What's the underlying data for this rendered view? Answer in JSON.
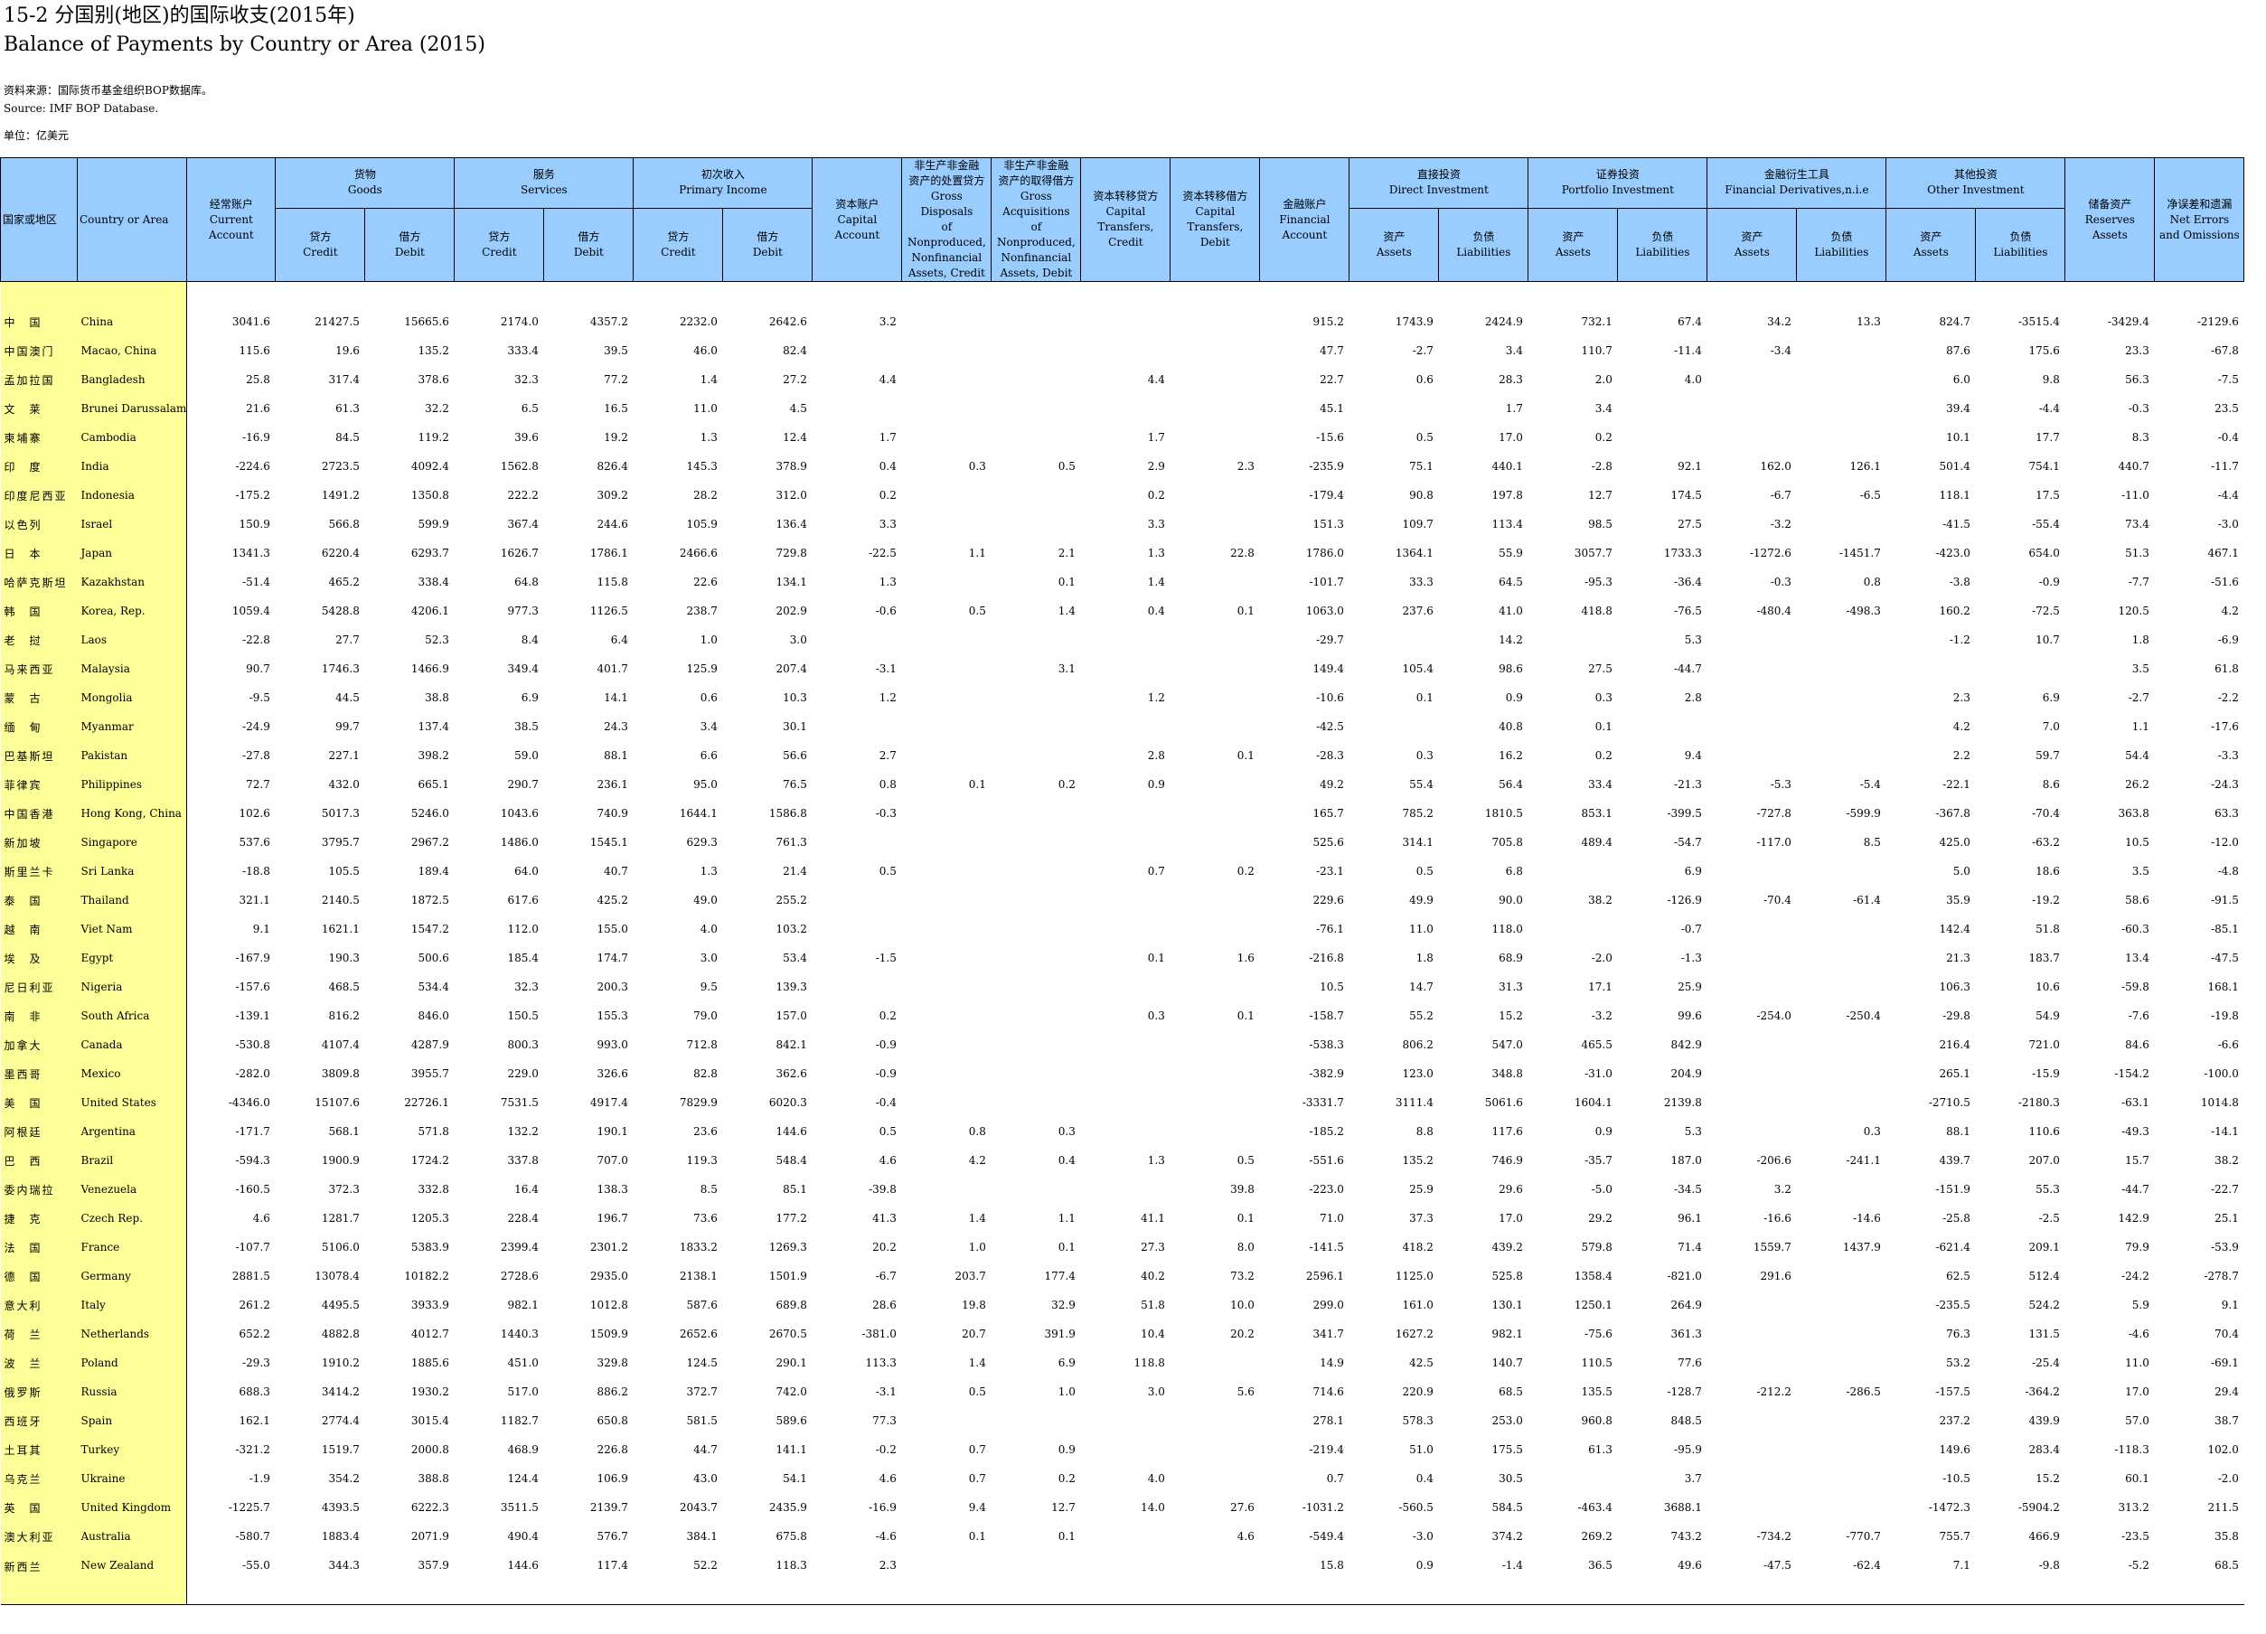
{
  "title_cn": "15-2  分国别(地区)的国际收支(2015年)",
  "title_en": "Balance of Payments by Country or Area (2015)",
  "source_cn": "资料来源：国际货币基金组织BOP数据库。",
  "source_en": "Source: IMF BOP Database.",
  "unit": "单位：亿美元",
  "headers": {
    "country_cn": "国家或地区",
    "country_en": "Country or Area",
    "current": [
      "经常账户",
      "Current",
      "Account"
    ],
    "goods": [
      "货物",
      "Goods"
    ],
    "services": [
      "服务",
      "Services"
    ],
    "primary": [
      "初次收入",
      "Primary Income"
    ],
    "credit": [
      "贷方",
      "Credit"
    ],
    "debit": [
      "借方",
      "Debit"
    ],
    "capital": [
      "资本账户",
      "Capital",
      "Account"
    ],
    "nonprod_credit": [
      "非生产非金融",
      "资产的处置贷方",
      "Gross Disposals",
      "of Nonproduced,",
      "Nonfinancial",
      "Assets, Credit"
    ],
    "nonprod_debit": [
      "非生产非金融",
      "资产的取得借方",
      "Gross Acquisitions",
      "of Nonproduced,",
      "Nonfinancial",
      "Assets, Debit"
    ],
    "cap_trans_credit": [
      "资本转移贷方",
      "Capital",
      "Transfers,",
      "Credit"
    ],
    "cap_trans_debit": [
      "资本转移借方",
      "Capital",
      "Transfers,",
      "Debit"
    ],
    "financial": [
      "金融账户",
      "Financial",
      "Account"
    ],
    "direct": [
      "直接投资",
      "Direct Investment"
    ],
    "portfolio": [
      "证券投资",
      "Portfolio Investment"
    ],
    "derivatives": [
      "金融衍生工具",
      "Financial Derivatives,n.i.e"
    ],
    "other": [
      "其他投资",
      "Other Investment"
    ],
    "assets": [
      "资产",
      "Assets"
    ],
    "liabilities": [
      "负债",
      "Liabilities"
    ],
    "reserves": [
      "储备资产",
      "Reserves",
      "Assets"
    ],
    "errors": [
      "净误差和遗漏",
      "Net Errors",
      "and Omissions"
    ]
  },
  "rows": [
    [
      "中　国",
      "China",
      "3041.6",
      "21427.5",
      "15665.6",
      "2174.0",
      "4357.2",
      "2232.0",
      "2642.6",
      "3.2",
      "",
      "",
      "",
      "",
      "915.2",
      "1743.9",
      "2424.9",
      "732.1",
      "67.4",
      "34.2",
      "13.3",
      "824.7",
      "-3515.4",
      "-3429.4",
      "-2129.6"
    ],
    [
      "中国澳门",
      "Macao, China",
      "115.6",
      "19.6",
      "135.2",
      "333.4",
      "39.5",
      "46.0",
      "82.4",
      "",
      "",
      "",
      "",
      "",
      "47.7",
      "-2.7",
      "3.4",
      "110.7",
      "-11.4",
      "-3.4",
      "",
      "87.6",
      "175.6",
      "23.3",
      "-67.8"
    ],
    [
      "孟加拉国",
      "Bangladesh",
      "25.8",
      "317.4",
      "378.6",
      "32.3",
      "77.2",
      "1.4",
      "27.2",
      "4.4",
      "",
      "",
      "4.4",
      "",
      "22.7",
      "0.6",
      "28.3",
      "2.0",
      "4.0",
      "",
      "",
      "6.0",
      "9.8",
      "56.3",
      "-7.5"
    ],
    [
      "文　莱",
      "Brunei Darussalam",
      "21.6",
      "61.3",
      "32.2",
      "6.5",
      "16.5",
      "11.0",
      "4.5",
      "",
      "",
      "",
      "",
      "",
      "45.1",
      "",
      "1.7",
      "3.4",
      "",
      "",
      "",
      "39.4",
      "-4.4",
      "-0.3",
      "23.5"
    ],
    [
      "柬埔寨",
      "Cambodia",
      "-16.9",
      "84.5",
      "119.2",
      "39.6",
      "19.2",
      "1.3",
      "12.4",
      "1.7",
      "",
      "",
      "1.7",
      "",
      "-15.6",
      "0.5",
      "17.0",
      "0.2",
      "",
      "",
      "",
      "10.1",
      "17.7",
      "8.3",
      "-0.4"
    ],
    [
      "印　度",
      "India",
      "-224.6",
      "2723.5",
      "4092.4",
      "1562.8",
      "826.4",
      "145.3",
      "378.9",
      "0.4",
      "0.3",
      "0.5",
      "2.9",
      "2.3",
      "-235.9",
      "75.1",
      "440.1",
      "-2.8",
      "92.1",
      "162.0",
      "126.1",
      "501.4",
      "754.1",
      "440.7",
      "-11.7"
    ],
    [
      "印度尼西亚",
      "Indonesia",
      "-175.2",
      "1491.2",
      "1350.8",
      "222.2",
      "309.2",
      "28.2",
      "312.0",
      "0.2",
      "",
      "",
      "0.2",
      "",
      "-179.4",
      "90.8",
      "197.8",
      "12.7",
      "174.5",
      "-6.7",
      "-6.5",
      "118.1",
      "17.5",
      "-11.0",
      "-4.4"
    ],
    [
      "以色列",
      "Israel",
      "150.9",
      "566.8",
      "599.9",
      "367.4",
      "244.6",
      "105.9",
      "136.4",
      "3.3",
      "",
      "",
      "3.3",
      "",
      "151.3",
      "109.7",
      "113.4",
      "98.5",
      "27.5",
      "-3.2",
      "",
      "-41.5",
      "-55.4",
      "73.4",
      "-3.0"
    ],
    [
      "日　本",
      "Japan",
      "1341.3",
      "6220.4",
      "6293.7",
      "1626.7",
      "1786.1",
      "2466.6",
      "729.8",
      "-22.5",
      "1.1",
      "2.1",
      "1.3",
      "22.8",
      "1786.0",
      "1364.1",
      "55.9",
      "3057.7",
      "1733.3",
      "-1272.6",
      "-1451.7",
      "-423.0",
      "654.0",
      "51.3",
      "467.1"
    ],
    [
      "哈萨克斯坦",
      "Kazakhstan",
      "-51.4",
      "465.2",
      "338.4",
      "64.8",
      "115.8",
      "22.6",
      "134.1",
      "1.3",
      "",
      "0.1",
      "1.4",
      "",
      "-101.7",
      "33.3",
      "64.5",
      "-95.3",
      "-36.4",
      "-0.3",
      "0.8",
      "-3.8",
      "-0.9",
      "-7.7",
      "-51.6"
    ],
    [
      "韩　国",
      "Korea, Rep.",
      "1059.4",
      "5428.8",
      "4206.1",
      "977.3",
      "1126.5",
      "238.7",
      "202.9",
      "-0.6",
      "0.5",
      "1.4",
      "0.4",
      "0.1",
      "1063.0",
      "237.6",
      "41.0",
      "418.8",
      "-76.5",
      "-480.4",
      "-498.3",
      "160.2",
      "-72.5",
      "120.5",
      "4.2"
    ],
    [
      "老　挝",
      "Laos",
      "-22.8",
      "27.7",
      "52.3",
      "8.4",
      "6.4",
      "1.0",
      "3.0",
      "",
      "",
      "",
      "",
      "",
      "-29.7",
      "",
      "14.2",
      "",
      "5.3",
      "",
      "",
      "-1.2",
      "10.7",
      "1.8",
      "-6.9"
    ],
    [
      "马来西亚",
      "Malaysia",
      "90.7",
      "1746.3",
      "1466.9",
      "349.4",
      "401.7",
      "125.9",
      "207.4",
      "-3.1",
      "",
      "3.1",
      "",
      "",
      "149.4",
      "105.4",
      "98.6",
      "27.5",
      "-44.7",
      "",
      "",
      "",
      "",
      "3.5",
      "61.8"
    ],
    [
      "蒙　古",
      "Mongolia",
      "-9.5",
      "44.5",
      "38.8",
      "6.9",
      "14.1",
      "0.6",
      "10.3",
      "1.2",
      "",
      "",
      "1.2",
      "",
      "-10.6",
      "0.1",
      "0.9",
      "0.3",
      "2.8",
      "",
      "",
      "2.3",
      "6.9",
      "-2.7",
      "-2.2"
    ],
    [
      "缅　甸",
      "Myanmar",
      "-24.9",
      "99.7",
      "137.4",
      "38.5",
      "24.3",
      "3.4",
      "30.1",
      "",
      "",
      "",
      "",
      "",
      "-42.5",
      "",
      "40.8",
      "0.1",
      "",
      "",
      "",
      "4.2",
      "7.0",
      "1.1",
      "-17.6"
    ],
    [
      "巴基斯坦",
      "Pakistan",
      "-27.8",
      "227.1",
      "398.2",
      "59.0",
      "88.1",
      "6.6",
      "56.6",
      "2.7",
      "",
      "",
      "2.8",
      "0.1",
      "-28.3",
      "0.3",
      "16.2",
      "0.2",
      "9.4",
      "",
      "",
      "2.2",
      "59.7",
      "54.4",
      "-3.3"
    ],
    [
      "菲律宾",
      "Philippines",
      "72.7",
      "432.0",
      "665.1",
      "290.7",
      "236.1",
      "95.0",
      "76.5",
      "0.8",
      "0.1",
      "0.2",
      "0.9",
      "",
      "49.2",
      "55.4",
      "56.4",
      "33.4",
      "-21.3",
      "-5.3",
      "-5.4",
      "-22.1",
      "8.6",
      "26.2",
      "-24.3"
    ],
    [
      "中国香港",
      "Hong Kong, China",
      "102.6",
      "5017.3",
      "5246.0",
      "1043.6",
      "740.9",
      "1644.1",
      "1586.8",
      "-0.3",
      "",
      "",
      "",
      "",
      "165.7",
      "785.2",
      "1810.5",
      "853.1",
      "-399.5",
      "-727.8",
      "-599.9",
      "-367.8",
      "-70.4",
      "363.8",
      "63.3"
    ],
    [
      "新加坡",
      "Singapore",
      "537.6",
      "3795.7",
      "2967.2",
      "1486.0",
      "1545.1",
      "629.3",
      "761.3",
      "",
      "",
      "",
      "",
      "",
      "525.6",
      "314.1",
      "705.8",
      "489.4",
      "-54.7",
      "-117.0",
      "8.5",
      "425.0",
      "-63.2",
      "10.5",
      "-12.0"
    ],
    [
      "斯里兰卡",
      "Sri Lanka",
      "-18.8",
      "105.5",
      "189.4",
      "64.0",
      "40.7",
      "1.3",
      "21.4",
      "0.5",
      "",
      "",
      "0.7",
      "0.2",
      "-23.1",
      "0.5",
      "6.8",
      "",
      "6.9",
      "",
      "",
      "5.0",
      "18.6",
      "3.5",
      "-4.8"
    ],
    [
      "泰　国",
      "Thailand",
      "321.1",
      "2140.5",
      "1872.5",
      "617.6",
      "425.2",
      "49.0",
      "255.2",
      "",
      "",
      "",
      "",
      "",
      "229.6",
      "49.9",
      "90.0",
      "38.2",
      "-126.9",
      "-70.4",
      "-61.4",
      "35.9",
      "-19.2",
      "58.6",
      "-91.5"
    ],
    [
      "越　南",
      "Viet Nam",
      "9.1",
      "1621.1",
      "1547.2",
      "112.0",
      "155.0",
      "4.0",
      "103.2",
      "",
      "",
      "",
      "",
      "",
      "-76.1",
      "11.0",
      "118.0",
      "",
      "-0.7",
      "",
      "",
      "142.4",
      "51.8",
      "-60.3",
      "-85.1"
    ],
    [
      "埃　及",
      "Egypt",
      "-167.9",
      "190.3",
      "500.6",
      "185.4",
      "174.7",
      "3.0",
      "53.4",
      "-1.5",
      "",
      "",
      "0.1",
      "1.6",
      "-216.8",
      "1.8",
      "68.9",
      "-2.0",
      "-1.3",
      "",
      "",
      "21.3",
      "183.7",
      "13.4",
      "-47.5"
    ],
    [
      "尼日利亚",
      "Nigeria",
      "-157.6",
      "468.5",
      "534.4",
      "32.3",
      "200.3",
      "9.5",
      "139.3",
      "",
      "",
      "",
      "",
      "",
      "10.5",
      "14.7",
      "31.3",
      "17.1",
      "25.9",
      "",
      "",
      "106.3",
      "10.6",
      "-59.8",
      "168.1"
    ],
    [
      "南　非",
      "South Africa",
      "-139.1",
      "816.2",
      "846.0",
      "150.5",
      "155.3",
      "79.0",
      "157.0",
      "0.2",
      "",
      "",
      "0.3",
      "0.1",
      "-158.7",
      "55.2",
      "15.2",
      "-3.2",
      "99.6",
      "-254.0",
      "-250.4",
      "-29.8",
      "54.9",
      "-7.6",
      "-19.8"
    ],
    [
      "加拿大",
      "Canada",
      "-530.8",
      "4107.4",
      "4287.9",
      "800.3",
      "993.0",
      "712.8",
      "842.1",
      "-0.9",
      "",
      "",
      "",
      "",
      "-538.3",
      "806.2",
      "547.0",
      "465.5",
      "842.9",
      "",
      "",
      "216.4",
      "721.0",
      "84.6",
      "-6.6"
    ],
    [
      "墨西哥",
      "Mexico",
      "-282.0",
      "3809.8",
      "3955.7",
      "229.0",
      "326.6",
      "82.8",
      "362.6",
      "-0.9",
      "",
      "",
      "",
      "",
      "-382.9",
      "123.0",
      "348.8",
      "-31.0",
      "204.9",
      "",
      "",
      "265.1",
      "-15.9",
      "-154.2",
      "-100.0"
    ],
    [
      "美　国",
      "United States",
      "-4346.0",
      "15107.6",
      "22726.1",
      "7531.5",
      "4917.4",
      "7829.9",
      "6020.3",
      "-0.4",
      "",
      "",
      "",
      "",
      "-3331.7",
      "3111.4",
      "5061.6",
      "1604.1",
      "2139.8",
      "",
      "",
      "-2710.5",
      "-2180.3",
      "-63.1",
      "1014.8"
    ],
    [
      "阿根廷",
      "Argentina",
      "-171.7",
      "568.1",
      "571.8",
      "132.2",
      "190.1",
      "23.6",
      "144.6",
      "0.5",
      "0.8",
      "0.3",
      "",
      "",
      "-185.2",
      "8.8",
      "117.6",
      "0.9",
      "5.3",
      "",
      "0.3",
      "88.1",
      "110.6",
      "-49.3",
      "-14.1"
    ],
    [
      "巴　西",
      "Brazil",
      "-594.3",
      "1900.9",
      "1724.2",
      "337.8",
      "707.0",
      "119.3",
      "548.4",
      "4.6",
      "4.2",
      "0.4",
      "1.3",
      "0.5",
      "-551.6",
      "135.2",
      "746.9",
      "-35.7",
      "187.0",
      "-206.6",
      "-241.1",
      "439.7",
      "207.0",
      "15.7",
      "38.2"
    ],
    [
      "委内瑞拉",
      "Venezuela",
      "-160.5",
      "372.3",
      "332.8",
      "16.4",
      "138.3",
      "8.5",
      "85.1",
      "-39.8",
      "",
      "",
      "",
      "39.8",
      "-223.0",
      "25.9",
      "29.6",
      "-5.0",
      "-34.5",
      "3.2",
      "",
      "-151.9",
      "55.3",
      "-44.7",
      "-22.7"
    ],
    [
      "捷　克",
      "Czech Rep.",
      "4.6",
      "1281.7",
      "1205.3",
      "228.4",
      "196.7",
      "73.6",
      "177.2",
      "41.3",
      "1.4",
      "1.1",
      "41.1",
      "0.1",
      "71.0",
      "37.3",
      "17.0",
      "29.2",
      "96.1",
      "-16.6",
      "-14.6",
      "-25.8",
      "-2.5",
      "142.9",
      "25.1"
    ],
    [
      "法　国",
      "France",
      "-107.7",
      "5106.0",
      "5383.9",
      "2399.4",
      "2301.2",
      "1833.2",
      "1269.3",
      "20.2",
      "1.0",
      "0.1",
      "27.3",
      "8.0",
      "-141.5",
      "418.2",
      "439.2",
      "579.8",
      "71.4",
      "1559.7",
      "1437.9",
      "-621.4",
      "209.1",
      "79.9",
      "-53.9"
    ],
    [
      "德　国",
      "Germany",
      "2881.5",
      "13078.4",
      "10182.2",
      "2728.6",
      "2935.0",
      "2138.1",
      "1501.9",
      "-6.7",
      "203.7",
      "177.4",
      "40.2",
      "73.2",
      "2596.1",
      "1125.0",
      "525.8",
      "1358.4",
      "-821.0",
      "291.6",
      "",
      "62.5",
      "512.4",
      "-24.2",
      "-278.7"
    ],
    [
      "意大利",
      "Italy",
      "261.2",
      "4495.5",
      "3933.9",
      "982.1",
      "1012.8",
      "587.6",
      "689.8",
      "28.6",
      "19.8",
      "32.9",
      "51.8",
      "10.0",
      "299.0",
      "161.0",
      "130.1",
      "1250.1",
      "264.9",
      "",
      "",
      "-235.5",
      "524.2",
      "5.9",
      "9.1"
    ],
    [
      "荷　兰",
      "Netherlands",
      "652.2",
      "4882.8",
      "4012.7",
      "1440.3",
      "1509.9",
      "2652.6",
      "2670.5",
      "-381.0",
      "20.7",
      "391.9",
      "10.4",
      "20.2",
      "341.7",
      "1627.2",
      "982.1",
      "-75.6",
      "361.3",
      "",
      "",
      "76.3",
      "131.5",
      "-4.6",
      "70.4"
    ],
    [
      "波　兰",
      "Poland",
      "-29.3",
      "1910.2",
      "1885.6",
      "451.0",
      "329.8",
      "124.5",
      "290.1",
      "113.3",
      "1.4",
      "6.9",
      "118.8",
      "",
      "14.9",
      "42.5",
      "140.7",
      "110.5",
      "77.6",
      "",
      "",
      "53.2",
      "-25.4",
      "11.0",
      "-69.1"
    ],
    [
      "俄罗斯",
      "Russia",
      "688.3",
      "3414.2",
      "1930.2",
      "517.0",
      "886.2",
      "372.7",
      "742.0",
      "-3.1",
      "0.5",
      "1.0",
      "3.0",
      "5.6",
      "714.6",
      "220.9",
      "68.5",
      "135.5",
      "-128.7",
      "-212.2",
      "-286.5",
      "-157.5",
      "-364.2",
      "17.0",
      "29.4"
    ],
    [
      "西班牙",
      "Spain",
      "162.1",
      "2774.4",
      "3015.4",
      "1182.7",
      "650.8",
      "581.5",
      "589.6",
      "77.3",
      "",
      "",
      "",
      "",
      "278.1",
      "578.3",
      "253.0",
      "960.8",
      "848.5",
      "",
      "",
      "237.2",
      "439.9",
      "57.0",
      "38.7"
    ],
    [
      "土耳其",
      "Turkey",
      "-321.2",
      "1519.7",
      "2000.8",
      "468.9",
      "226.8",
      "44.7",
      "141.1",
      "-0.2",
      "0.7",
      "0.9",
      "",
      "",
      "-219.4",
      "51.0",
      "175.5",
      "61.3",
      "-95.9",
      "",
      "",
      "149.6",
      "283.4",
      "-118.3",
      "102.0"
    ],
    [
      "乌克兰",
      "Ukraine",
      "-1.9",
      "354.2",
      "388.8",
      "124.4",
      "106.9",
      "43.0",
      "54.1",
      "4.6",
      "0.7",
      "0.2",
      "4.0",
      "",
      "0.7",
      "0.4",
      "30.5",
      "",
      "3.7",
      "",
      "",
      "-10.5",
      "15.2",
      "60.1",
      "-2.0"
    ],
    [
      "英　国",
      "United Kingdom",
      "-1225.7",
      "4393.5",
      "6222.3",
      "3511.5",
      "2139.7",
      "2043.7",
      "2435.9",
      "-16.9",
      "9.4",
      "12.7",
      "14.0",
      "27.6",
      "-1031.2",
      "-560.5",
      "584.5",
      "-463.4",
      "3688.1",
      "",
      "",
      "-1472.3",
      "-5904.2",
      "313.2",
      "211.5"
    ],
    [
      "澳大利亚",
      "Australia",
      "-580.7",
      "1883.4",
      "2071.9",
      "490.4",
      "576.7",
      "384.1",
      "675.8",
      "-4.6",
      "0.1",
      "0.1",
      "",
      "4.6",
      "-549.4",
      "-3.0",
      "374.2",
      "269.2",
      "743.2",
      "-734.2",
      "-770.7",
      "755.7",
      "466.9",
      "-23.5",
      "35.8"
    ],
    [
      "新西兰",
      "New Zealand",
      "-55.0",
      "344.3",
      "357.9",
      "144.6",
      "117.4",
      "52.2",
      "118.3",
      "2.3",
      "",
      "",
      "",
      "",
      "15.8",
      "0.9",
      "-1.4",
      "36.5",
      "49.6",
      "-47.5",
      "-62.4",
      "7.1",
      "-9.8",
      "-5.2",
      "68.5"
    ]
  ]
}
